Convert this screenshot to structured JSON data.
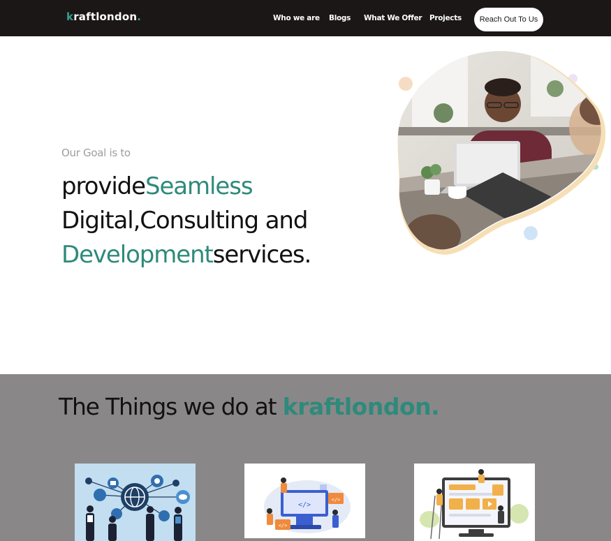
{
  "nav": {
    "logo": "kraftlondon.",
    "links": [
      "Who we are",
      "Blogs",
      "What We Offer",
      "Projects"
    ],
    "cta": "Reach Out To Us"
  },
  "hero": {
    "intro": "Our Goal is to",
    "line1_a": "provide",
    "line1_b": "Seamless",
    "line2": "Digital,Consulting and",
    "line3_a": "Development",
    "line3_b": "services."
  },
  "things": {
    "title": "The Things we do at",
    "brand": "kraftlondon."
  },
  "colors": {
    "nav_bg": "#1b1716",
    "accent": "#2e8a7b",
    "section_bg": "#8a8788"
  }
}
